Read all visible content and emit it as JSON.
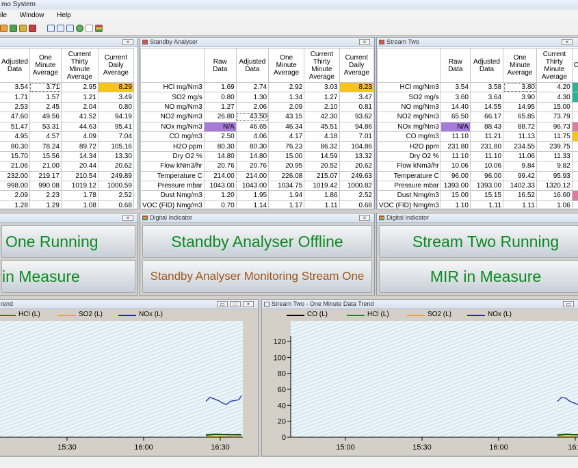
{
  "app": {
    "title": "mo System",
    "menu": [
      "ile",
      "Window",
      "Help"
    ]
  },
  "icons": {
    "toolbar": [
      "arrow-icon",
      "users-icon",
      "user-icon",
      "export-icon",
      "window-icon",
      "chart-icon",
      "bar-chart-icon",
      "settings-icon",
      "document-icon",
      "indicator-icon"
    ]
  },
  "left_table": {
    "headers": [
      "Adjusted Data",
      "One Minute Average",
      "Current Thirty Minute Average",
      "Current Daily Average"
    ],
    "rows": [
      [
        "3.54",
        "3.71",
        "2.95",
        "8.29"
      ],
      [
        "1.71",
        "1.57",
        "1.21",
        "3.49"
      ],
      [
        "2.53",
        "2.45",
        "2.04",
        "0.80"
      ],
      [
        "47.60",
        "49.56",
        "41.52",
        "94.19"
      ],
      [
        "51.47",
        "53.31",
        "44.63",
        "95.41"
      ],
      [
        "4.95",
        "4.57",
        "4.09",
        "7.04"
      ],
      [
        "80.30",
        "78.24",
        "89.72",
        "105.16"
      ],
      [
        "15.70",
        "15.56",
        "14.34",
        "13.30"
      ],
      [
        "21.06",
        "21.00",
        "20.44",
        "20.62"
      ],
      [
        "232.00",
        "219.17",
        "210.54",
        "249.89"
      ],
      [
        "998.00",
        "990.08",
        "1019.12",
        "1000.59"
      ],
      [
        "2.09",
        "2.23",
        "1.78",
        "2.52"
      ],
      [
        "1.28",
        "1.29",
        "1.08",
        "0.68"
      ]
    ]
  },
  "standby_table": {
    "title": "Standby Analyser",
    "headers": [
      "",
      "Raw Data",
      "Adjusted Data",
      "One Minute Average",
      "Current Thirty Minute Average",
      "Current Daily Average"
    ],
    "rows": [
      [
        "HCl mg/Nm3",
        "1.69",
        "2.74",
        "2.92",
        "3.03",
        "8.23"
      ],
      [
        "SO2 mg/s",
        "0.80",
        "1.30",
        "1.34",
        "1.27",
        "3.47"
      ],
      [
        "NO mg/Nm3",
        "1.27",
        "2.06",
        "2.09",
        "2.10",
        "0.81"
      ],
      [
        "NO2 mg/Nm3",
        "26.80",
        "43.50",
        "43.15",
        "42.30",
        "93.62"
      ],
      [
        "NOx mg/Nm3",
        "N/A",
        "46.65",
        "46.34",
        "45.51",
        "94.86"
      ],
      [
        "CO mg/m3",
        "2.50",
        "4.06",
        "4.17",
        "4.18",
        "7.01"
      ],
      [
        "H2O ppm",
        "80.30",
        "80.30",
        "76.23",
        "86.32",
        "104.86"
      ],
      [
        "Dry O2 %",
        "14.80",
        "14.80",
        "15.00",
        "14.59",
        "13.32"
      ],
      [
        "Flow kNm3/hr",
        "20.76",
        "20.76",
        "20.95",
        "20.52",
        "20.62"
      ],
      [
        "Temperature C",
        "214.00",
        "214.00",
        "226.08",
        "215.07",
        "249.63"
      ],
      [
        "Pressure mbar",
        "1043.00",
        "1043.00",
        "1034.75",
        "1019.42",
        "1000.82"
      ],
      [
        "Dust Nmg/m3",
        "1.20",
        "1.95",
        "1.94",
        "1.86",
        "2.52"
      ],
      [
        "VOC (FID) Nmg/m3",
        "0.70",
        "1.14",
        "1.17",
        "1.11",
        "0.68"
      ]
    ]
  },
  "stream_two_table": {
    "title": "Stream Two",
    "headers": [
      "",
      "Raw Data",
      "Adjusted Data",
      "One Minute Average",
      "Current Thirty Minute Average",
      "C"
    ],
    "rows": [
      [
        "HCl mg/Nm3",
        "3.54",
        "3.58",
        "3.80",
        "4.20"
      ],
      [
        "SO2 mg/s",
        "3.60",
        "3.64",
        "3.90",
        "4.30"
      ],
      [
        "NO mg/Nm3",
        "14.40",
        "14.55",
        "14.95",
        "15.00"
      ],
      [
        "NO2 mg/Nm3",
        "65.50",
        "66.17",
        "65.85",
        "73.79"
      ],
      [
        "NOx mg/Nm3",
        "N/A",
        "88.43",
        "88.72",
        "96.73"
      ],
      [
        "CO mg/m3",
        "11.10",
        "11.21",
        "11.13",
        "11.75"
      ],
      [
        "H2O ppm",
        "231.80",
        "231.80",
        "234.55",
        "239.75"
      ],
      [
        "Dry O2 %",
        "11.10",
        "11.10",
        "11.06",
        "11.33"
      ],
      [
        "Flow kNm3/hr",
        "10.06",
        "10.06",
        "9.84",
        "9.82"
      ],
      [
        "Temperature C",
        "96.00",
        "96.00",
        "99.42",
        "95.93"
      ],
      [
        "Pressure mbar",
        "1393.00",
        "1393.00",
        "1402.33",
        "1320.12"
      ],
      [
        "Dust Nmg/m3",
        "15.00",
        "15.15",
        "16.52",
        "16.60"
      ],
      [
        "VOC (FID) Nmg/m3",
        "1.10",
        "1.11",
        "1.11",
        "1.06"
      ]
    ]
  },
  "indicators": [
    {
      "title": "",
      "top": "One Running",
      "bottom": "in Measure"
    },
    {
      "title": "Digital Indicator",
      "top": "Standby Analyser Offline",
      "bottom": "Standby Analyser Monitoring Stream One"
    },
    {
      "title": "Digital Indicator",
      "top": "Stream Two Running",
      "bottom": "MIR in Measure"
    }
  ],
  "trend_left": {
    "title": "rend",
    "legend": [
      "HCl (L)",
      "SO2 (L)",
      "NOx (L)"
    ],
    "xticks": [
      "15:30",
      "16:00",
      "16:30"
    ]
  },
  "trend_right": {
    "title": "Stream Two - One Minute Data Trend",
    "legend": [
      "CO (L)",
      "HCl (L)",
      "SO2 (L)",
      "NOx (L)"
    ],
    "yticks": [
      "120",
      "100",
      "80",
      "60",
      "40",
      "20",
      "0"
    ],
    "xticks": [
      "15:00",
      "15:30",
      "16:00",
      "16:3"
    ]
  },
  "colors": {
    "co": "#000000",
    "hcl": "#1c8a1c",
    "so2": "#f0a030",
    "nox": "#1a2aa8",
    "bar": "#27b59a",
    "yellow": "#f5c518",
    "na": "#a77cd8",
    "pink": "#e07aa0"
  }
}
